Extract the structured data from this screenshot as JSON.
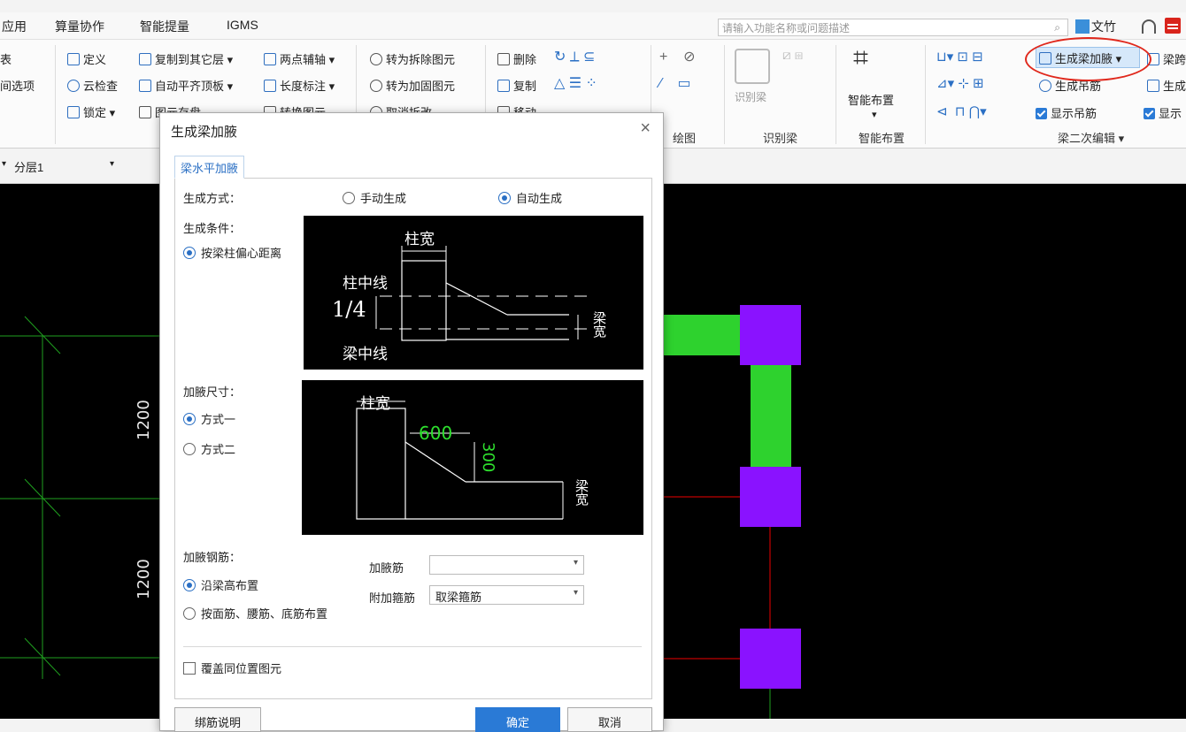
{
  "menu": {
    "items": [
      "应用",
      "算量协作",
      "智能提量",
      "IGMS"
    ],
    "search_placeholder": "请输入功能名称或问题描述",
    "user": "文竹"
  },
  "ribbon": {
    "col0": [
      "表",
      "间选项"
    ],
    "col1": [
      "定义",
      "云检查",
      "锁定"
    ],
    "col2": [
      "复制到其它层",
      "自动平齐顶板",
      "图元存盘"
    ],
    "col3": [
      "两点辅轴",
      "长度标注",
      "转换图元"
    ],
    "col4": [
      "转为拆除图元",
      "转为加固图元",
      "取消拆改"
    ],
    "col5": [
      "删除",
      "复制",
      "移动"
    ],
    "identify_beam": "识别梁",
    "smart_layout": "智能布置",
    "beam2": {
      "gen_haunch": "生成梁加腋",
      "beam_span": "梁跨",
      "gen_hanger": "生成吊筋",
      "gen_more": "生成",
      "show_hanger": "显示吊筋",
      "show_more": "显示"
    },
    "groups": {
      "draw": "绘图",
      "identify": "识别梁",
      "smart": "智能布置",
      "beam_edit": "梁二次编辑"
    }
  },
  "layerbar": {
    "layer": "分层1"
  },
  "canvas": {
    "dims": [
      "1200",
      "1200"
    ]
  },
  "dialog": {
    "title": "生成梁加腋",
    "tab": "梁水平加腋",
    "gen_mode_label": "生成方式：",
    "gen_manual": "手动生成",
    "gen_auto": "自动生成",
    "condition_label": "生成条件：",
    "condition_option": "按梁柱偏心距离",
    "size_label": "加腋尺寸：",
    "size_opt1": "方式一",
    "size_opt2": "方式二",
    "rebar_label": "加腋钢筋：",
    "rebar_opt1": "沿梁高布置",
    "rebar_opt2": "按面筋、腰筋、底筋布置",
    "haunch_bar_label": "加腋筋",
    "haunch_bar_value": "",
    "stirrup_label": "附加箍筋",
    "stirrup_value": "取梁箍筋",
    "overwrite": "覆盖同位置图元",
    "help_btn": "绑筋说明",
    "ok_btn": "确定",
    "cancel_btn": "取消",
    "img1": {
      "col_width": "柱宽",
      "col_center": "柱中线",
      "quarter": "1/4",
      "beam_center": "梁中线",
      "beam_width": "梁宽"
    },
    "img2": {
      "col_width": "柱宽",
      "len": "600",
      "height": "300",
      "beam_width": "梁宽"
    }
  }
}
